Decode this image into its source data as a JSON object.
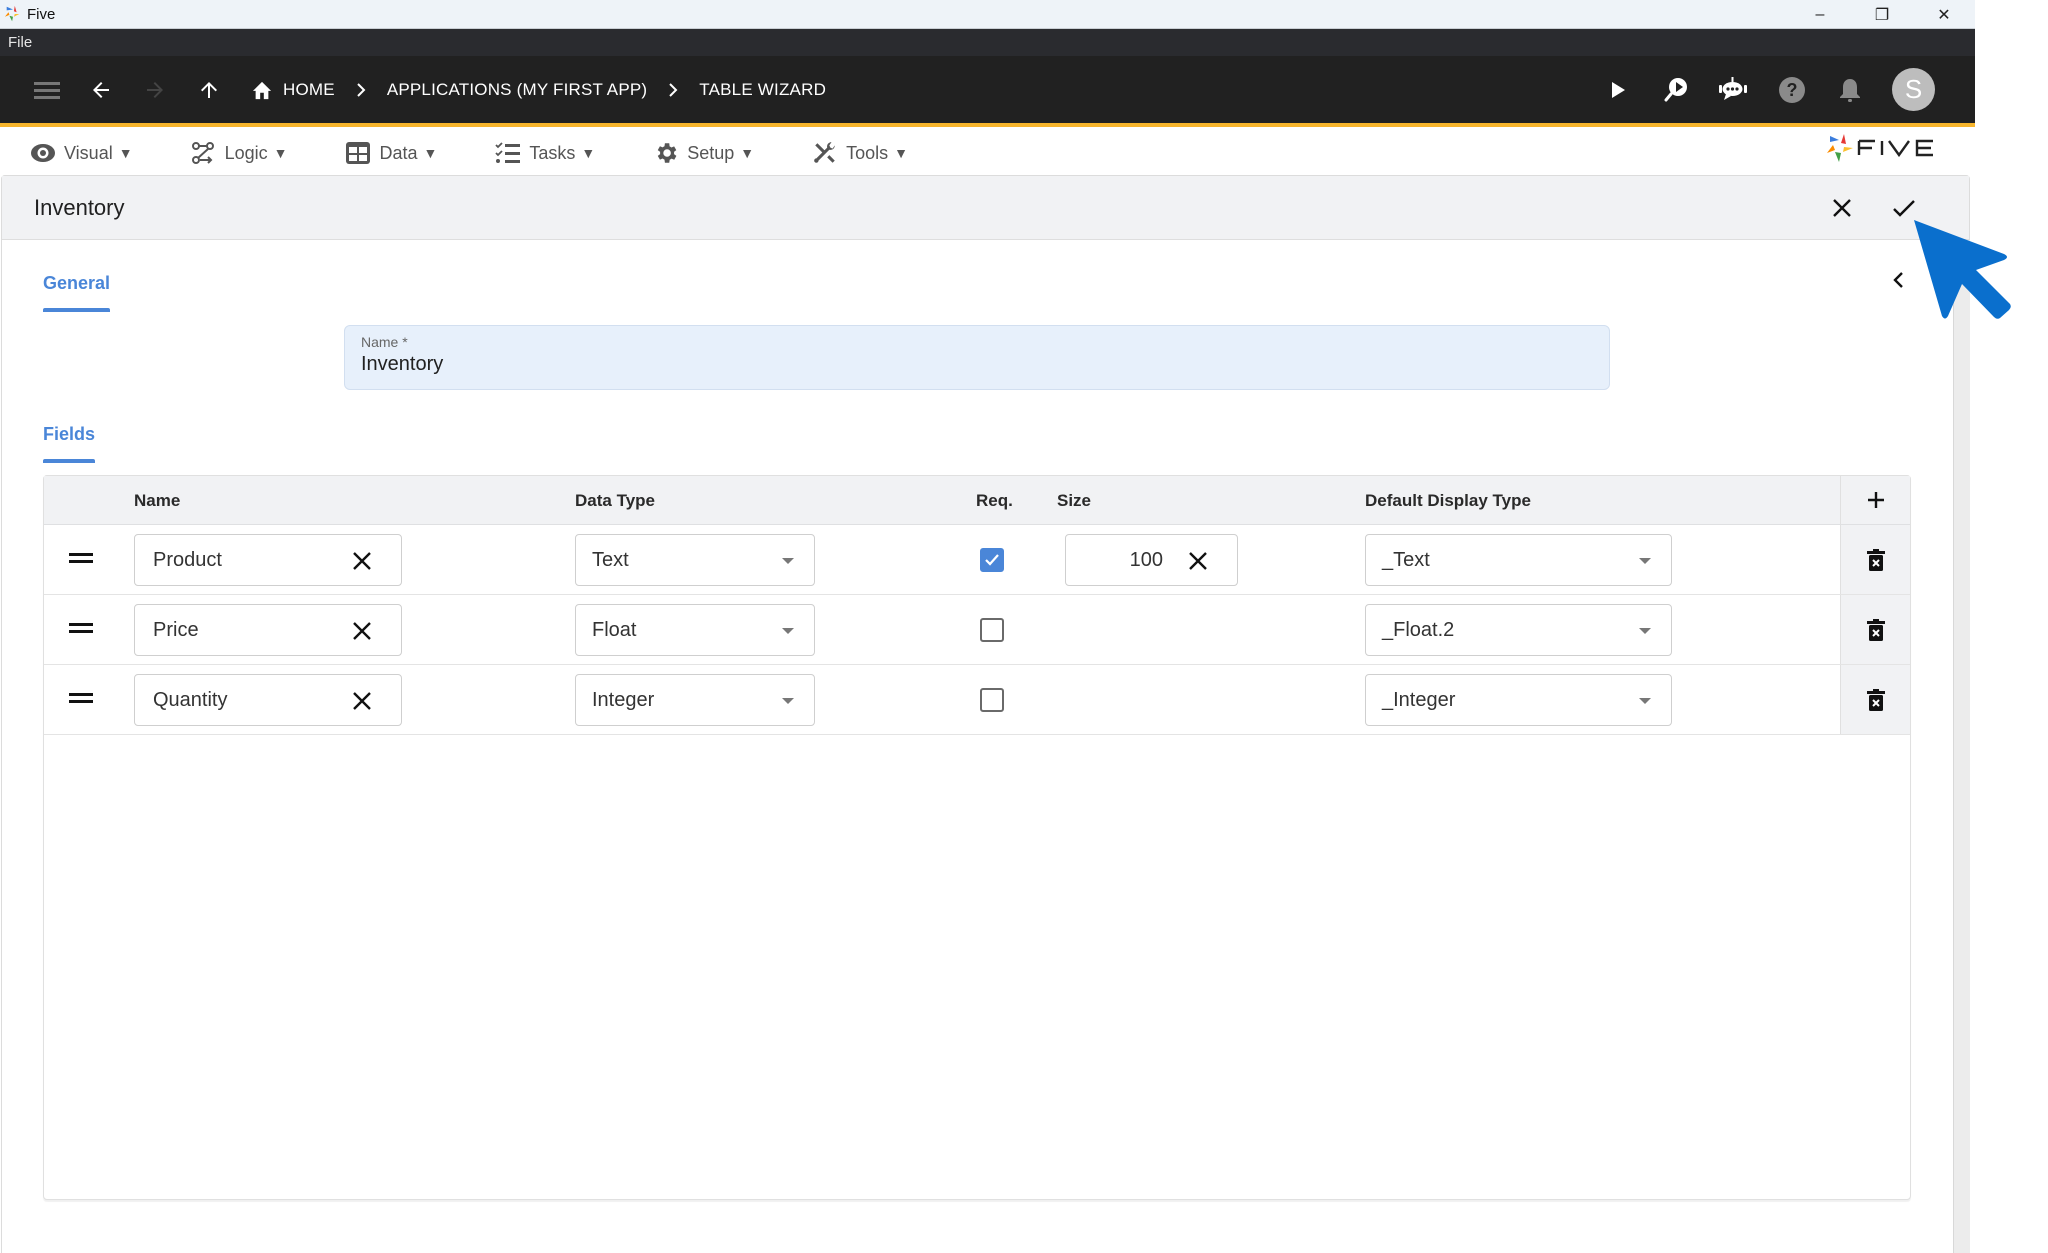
{
  "window": {
    "title": "Five",
    "controls": {
      "minimize": "–",
      "restore": "❐",
      "close": "✕"
    }
  },
  "menubar": {
    "items": [
      {
        "label": "File"
      }
    ]
  },
  "appbar": {
    "icons": [
      "menu-icon",
      "back-icon",
      "forward-icon",
      "up-icon"
    ],
    "breadcrumbs": [
      {
        "label": "HOME",
        "icon": "home-icon"
      },
      {
        "label": "APPLICATIONS (MY FIRST APP)"
      },
      {
        "label": "TABLE WIZARD"
      }
    ],
    "right_icons": [
      "play-icon",
      "search-play-icon",
      "chat-bot-icon",
      "help-icon",
      "bell-icon"
    ],
    "avatar_initial": "S"
  },
  "toolbar": {
    "menus": [
      {
        "label": "Visual",
        "icon": "eye-icon"
      },
      {
        "label": "Logic",
        "icon": "logic-icon"
      },
      {
        "label": "Data",
        "icon": "table-icon"
      },
      {
        "label": "Tasks",
        "icon": "tasks-icon"
      },
      {
        "label": "Setup",
        "icon": "gear-icon"
      },
      {
        "label": "Tools",
        "icon": "tools-icon"
      }
    ],
    "caret": "▼",
    "logo_text": "FIVE"
  },
  "panel": {
    "title": "Inventory",
    "tabs": {
      "general": "General",
      "fields": "Fields"
    },
    "name_field": {
      "label": "Name *",
      "value": "Inventory"
    }
  },
  "grid": {
    "columns": {
      "name": "Name",
      "data_type": "Data Type",
      "req": "Req.",
      "size": "Size",
      "display_type": "Default Display Type"
    },
    "rows": [
      {
        "name": "Product",
        "data_type": "Text",
        "required": true,
        "size": "100",
        "display_type": "_Text"
      },
      {
        "name": "Price",
        "data_type": "Float",
        "required": false,
        "size": "",
        "display_type": "_Float.2"
      },
      {
        "name": "Quantity",
        "data_type": "Integer",
        "required": false,
        "size": "",
        "display_type": "_Integer"
      }
    ]
  },
  "colors": {
    "accent": "#4a86d8",
    "appbar": "#212121",
    "appbar_border": "#f7b52c",
    "cursor": "#0a6fcd"
  }
}
